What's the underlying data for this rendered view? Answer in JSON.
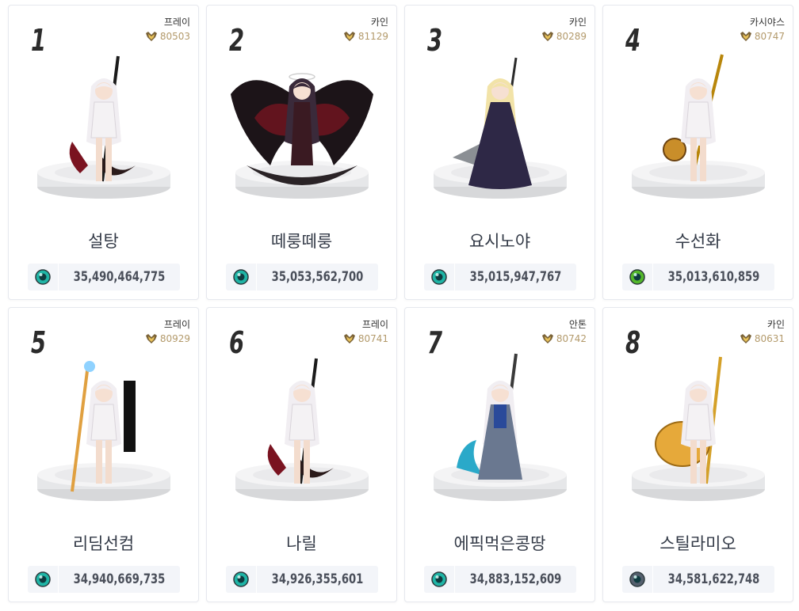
{
  "cards": [
    {
      "rank": "1",
      "server": "프레이",
      "fame": "80503",
      "name": "설탕",
      "power": "35,490,464,775",
      "icon": "teal-orb-icon",
      "icon_color": "#1fb5a6",
      "figure": "scythe"
    },
    {
      "rank": "2",
      "server": "카인",
      "fame": "81129",
      "name": "떼룽떼룽",
      "power": "35,053,562,700",
      "icon": "teal-orb-icon",
      "icon_color": "#1fb5a6",
      "figure": "wings"
    },
    {
      "rank": "3",
      "server": "카인",
      "fame": "80289",
      "name": "요시노야",
      "power": "35,015,947,767",
      "icon": "teal-orb-icon",
      "icon_color": "#1fb5a6",
      "figure": "gown"
    },
    {
      "rank": "4",
      "server": "카시야스",
      "fame": "80747",
      "name": "수선화",
      "power": "35,013,610,859",
      "icon": "green-orb-icon",
      "icon_color": "#53b82a",
      "figure": "spear"
    },
    {
      "rank": "5",
      "server": "프레이",
      "fame": "80929",
      "name": "리딤선컴",
      "power": "34,940,669,735",
      "icon": "teal-orb-icon",
      "icon_color": "#1fb5a6",
      "figure": "staff"
    },
    {
      "rank": "6",
      "server": "프레이",
      "fame": "80741",
      "name": "나릴",
      "power": "34,926,355,601",
      "icon": "teal-orb-icon",
      "icon_color": "#1fb5a6",
      "figure": "scythe"
    },
    {
      "rank": "7",
      "server": "안톤",
      "fame": "80742",
      "name": "에픽먹은콩땅",
      "power": "34,883,152,609",
      "icon": "teal-orb-icon",
      "icon_color": "#1fb5a6",
      "figure": "blue"
    },
    {
      "rank": "8",
      "server": "카인",
      "fame": "80631",
      "name": "스틸라미오",
      "power": "34,581,622,748",
      "icon": "dark-orb-icon",
      "icon_color": "#55606e",
      "figure": "golden"
    }
  ],
  "colors": {
    "fame_text": "#b39a6b",
    "name_text": "#333a47",
    "power_bg": "#f3f5f9"
  }
}
